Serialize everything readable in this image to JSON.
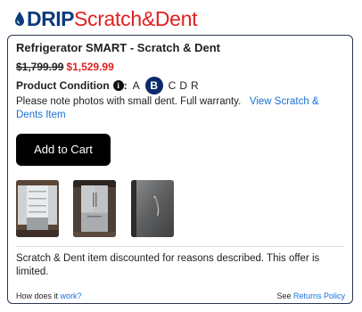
{
  "brand": {
    "primary": "DRIP",
    "secondary": "Scratch&Dent",
    "primary_color": "#0c3b7c",
    "secondary_color": "#e0211f"
  },
  "product": {
    "title": "Refrigerator SMART - Scratch & Dent",
    "old_price": "$1,799.99",
    "new_price": "$1,529.99",
    "condition_label": "Product Condition",
    "condition_options": [
      "A",
      "B",
      "C",
      "D",
      "R"
    ],
    "selected_condition": "B",
    "note": "Please note photos with small dent.  Full warranty.",
    "note_link": "View Scratch & Dents Item",
    "cart_label": "Add to Cart",
    "disclaimer": "Scratch & Dent item discounted for reasons described. This offer is limited."
  },
  "footer": {
    "how_prefix": "How does it",
    "how_link": "work?",
    "see_prefix": "See",
    "returns_link": "Returns Policy"
  }
}
